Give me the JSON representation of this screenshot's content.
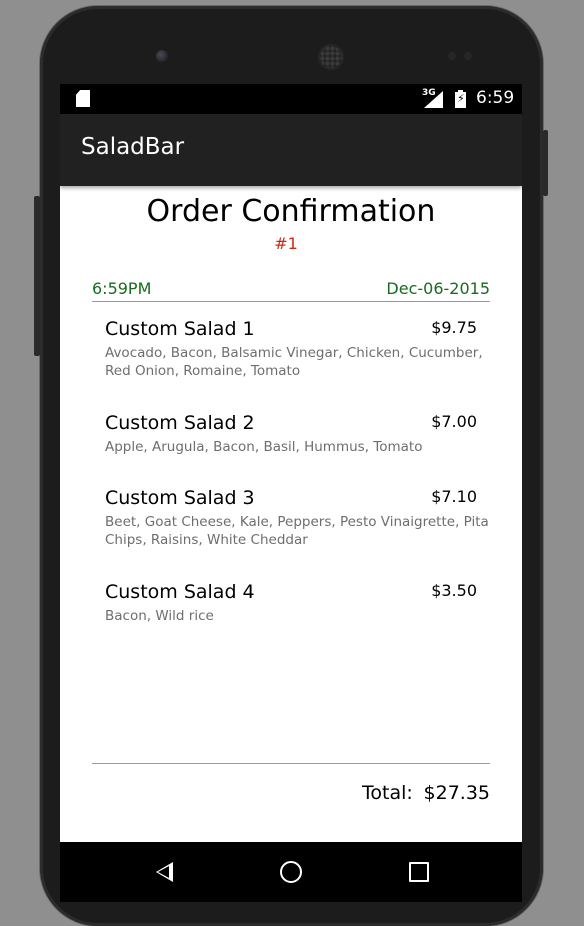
{
  "status_bar": {
    "network": "3G",
    "time": "6:59",
    "icons": [
      "sd-card-icon",
      "signal-icon",
      "battery-charging-icon"
    ]
  },
  "app_bar": {
    "title": "SaladBar"
  },
  "order": {
    "title": "Order Confirmation",
    "number": "#1",
    "time": "6:59PM",
    "date": "Dec-06-2015",
    "items": [
      {
        "name": "Custom Salad 1",
        "price": "$9.75",
        "ingredients": "Avocado, Bacon, Balsamic Vinegar, Chicken, Cucumber, Red Onion, Romaine, Tomato"
      },
      {
        "name": "Custom Salad 2",
        "price": "$7.00",
        "ingredients": "Apple, Arugula, Bacon, Basil, Hummus, Tomato"
      },
      {
        "name": "Custom Salad 3",
        "price": "$7.10",
        "ingredients": "Beet, Goat Cheese, Kale, Peppers, Pesto Vinaigrette, Pita Chips, Raisins, White Cheddar"
      },
      {
        "name": "Custom Salad 4",
        "price": "$3.50",
        "ingredients": "Bacon, Wild rice"
      }
    ],
    "total_label": "Total:",
    "total_value": "$27.35"
  },
  "nav_bar": {
    "buttons": [
      "back-icon",
      "home-icon",
      "recent-apps-icon"
    ]
  },
  "colors": {
    "app_bar": "#212121",
    "order_number": "#cc2a10",
    "timestamp": "#196b1f",
    "secondary_text": "#6e6e6e"
  }
}
